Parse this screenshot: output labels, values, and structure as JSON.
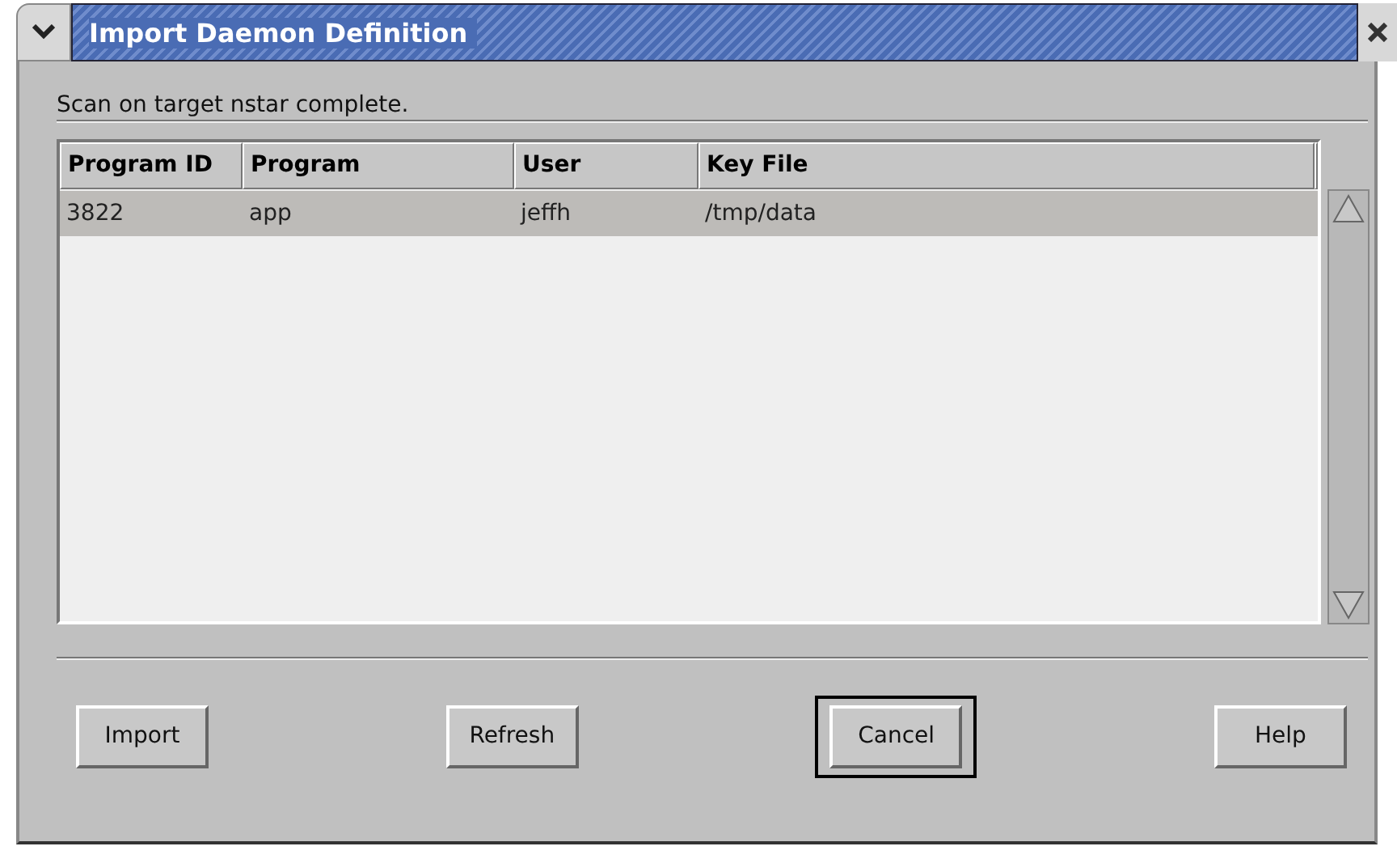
{
  "window": {
    "title": "Import Daemon Definition"
  },
  "message": "Scan on target nstar complete.",
  "table": {
    "columns": [
      "Program ID",
      "Program",
      "User",
      "Key File"
    ],
    "rows": [
      {
        "cells": [
          "3822",
          "app",
          "jeffh",
          "/tmp/data"
        ],
        "selected": true
      }
    ]
  },
  "buttons": [
    {
      "label": "Import",
      "default": false
    },
    {
      "label": "Refresh",
      "default": false
    },
    {
      "label": "Cancel",
      "default": true
    },
    {
      "label": "Help",
      "default": false
    }
  ]
}
